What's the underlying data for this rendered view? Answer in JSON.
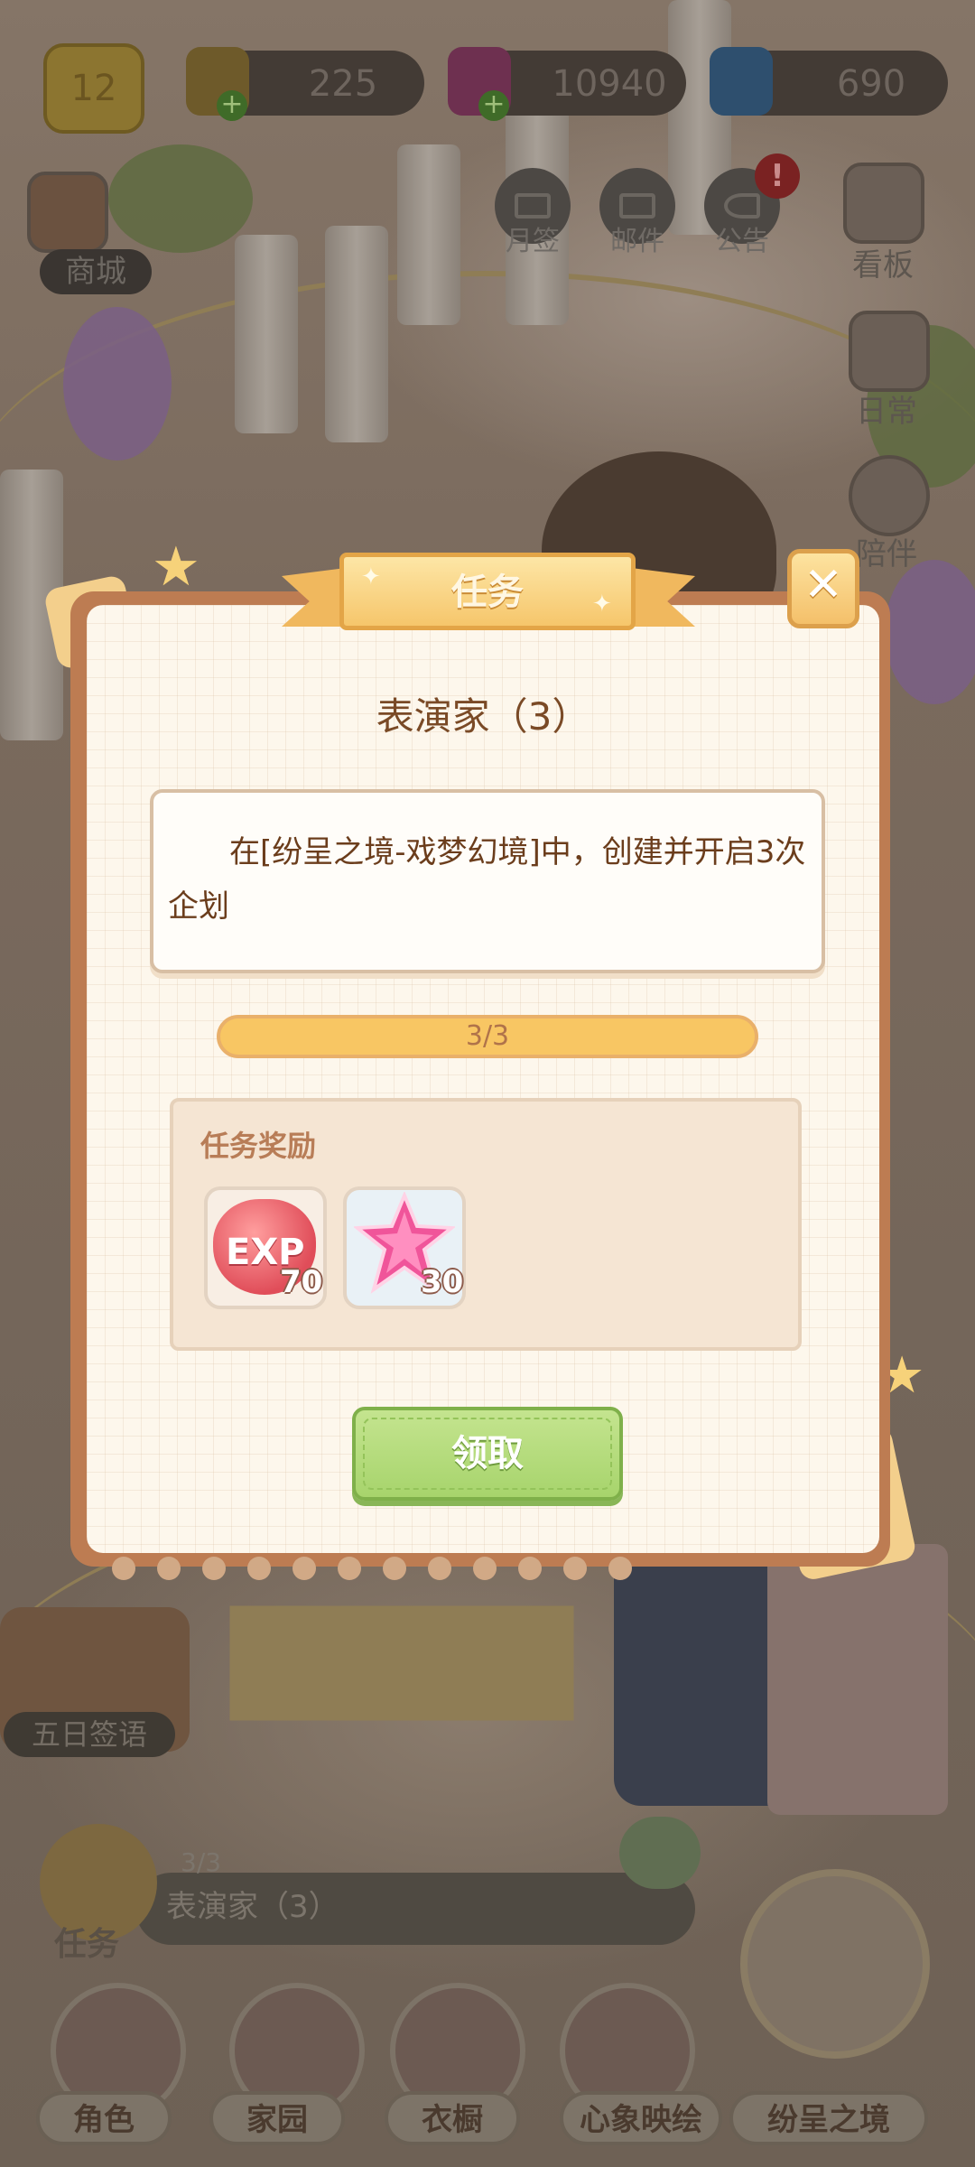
{
  "hud": {
    "level": "12",
    "resources": [
      {
        "icon": "bell-icon",
        "value": "225"
      },
      {
        "icon": "pink-gem-icon",
        "value": "10940"
      },
      {
        "icon": "snowflake-gem-icon",
        "value": "690"
      }
    ],
    "shop_label": "商城",
    "top_buttons": [
      {
        "label": "月签",
        "icon": "envelope-icon"
      },
      {
        "label": "邮件",
        "icon": "envelope-icon"
      },
      {
        "label": "公告",
        "icon": "megaphone-icon"
      }
    ],
    "side_buttons": [
      "看板",
      "日常",
      "陪伴"
    ],
    "five_day_label": "五日签语",
    "task_widget": {
      "count": "3/3",
      "name": "表演家（3）",
      "label": "任务"
    },
    "bottom_nav": [
      "角色",
      "家园",
      "衣橱",
      "心象映绘",
      "纷呈之境"
    ]
  },
  "dialog": {
    "ribbon_title": "任务",
    "title": "表演家（3）",
    "description": "在[纷呈之境-戏梦幻境]中，创建并开启3次企划",
    "progress": {
      "text": "3/3",
      "fraction": 1.0
    },
    "rewards_title": "任务奖励",
    "rewards": [
      {
        "icon": "exp-icon",
        "label": "EXP",
        "count": "70"
      },
      {
        "icon": "pink-star-gem-icon",
        "count": "30"
      }
    ],
    "claim_label": "领取"
  },
  "colors": {
    "dialog_border": "#bd7c52",
    "ribbon": "#f6c66b",
    "progress": "#f6c15e",
    "claim_button": "#a7d46c"
  }
}
